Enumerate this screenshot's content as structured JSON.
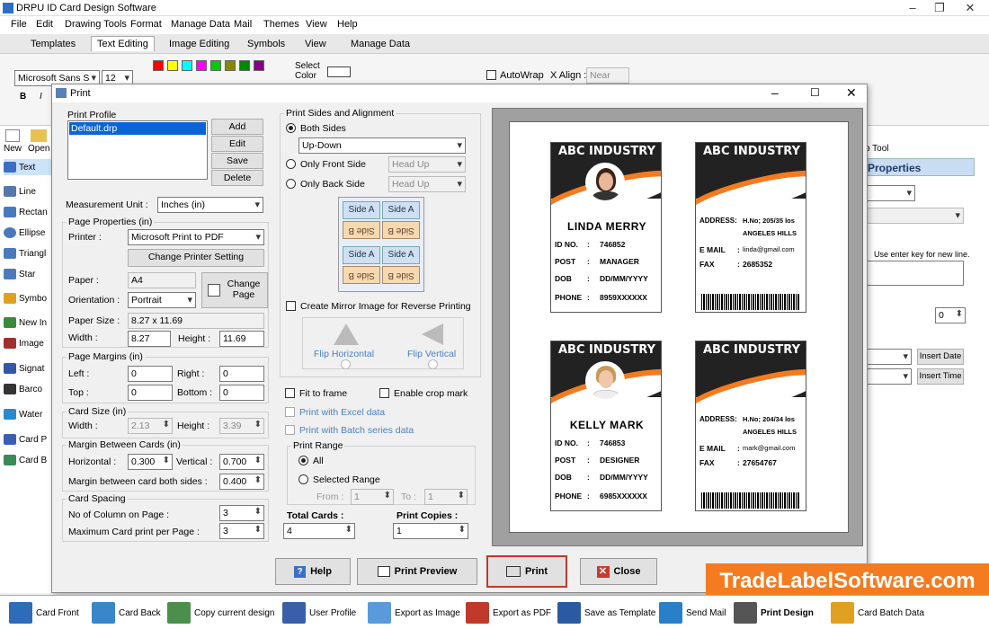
{
  "app": {
    "title": "DRPU ID Card Design Software"
  },
  "menu": [
    "File",
    "Edit",
    "Drawing Tools",
    "Format",
    "Manage Data",
    "Mail",
    "Themes",
    "View",
    "Help"
  ],
  "tabs": [
    "Templates",
    "Text Editing",
    "Image Editing",
    "Symbols",
    "View",
    "Manage Data"
  ],
  "ribbon": {
    "font": "Microsoft Sans S",
    "size": "12",
    "select_color": "Select Color",
    "autowrap": "AutoWrap",
    "xalign": "X Align :",
    "xalign_val": "Near"
  },
  "left_panel": {
    "new": "New",
    "open": "Open",
    "items": [
      "Text",
      "Line",
      "Rectan",
      "Ellipse",
      "Triangl",
      "Star",
      "Symbo",
      "New In",
      "Image",
      "Signat",
      "Barco",
      "Water",
      "Card P",
      "Card B"
    ]
  },
  "right_panel": {
    "tool": "p Tool",
    "properties": "Properties",
    "note": "Use enter key for new line.",
    "spin": "0",
    "insert_date": "Insert Date",
    "insert_time": "Insert Time"
  },
  "dialog": {
    "title": "Print",
    "print_profile": {
      "label": "Print Profile",
      "items": [
        "Default.drp"
      ],
      "add": "Add",
      "edit": "Edit",
      "save": "Save",
      "delete": "Delete"
    },
    "measurement": {
      "label": "Measurement Unit :",
      "value": "Inches (in)"
    },
    "page_props": {
      "label": "Page Properties (in)",
      "printer_label": "Printer :",
      "printer": "Microsoft Print to PDF",
      "change_printer": "Change Printer Setting",
      "paper_label": "Paper :",
      "paper": "A4",
      "orientation_label": "Orientation :",
      "orientation": "Portrait",
      "change_page": "Change Page",
      "paper_size_label": "Paper Size :",
      "paper_size": "8.27 x 11.69",
      "width_label": "Width :",
      "width": "8.27",
      "height_label": "Height :",
      "height": "11.69"
    },
    "margins": {
      "label": "Page Margins (in)",
      "left_label": "Left :",
      "left": "0",
      "right_label": "Right :",
      "right": "0",
      "top_label": "Top :",
      "top": "0",
      "bottom_label": "Bottom :",
      "bottom": "0"
    },
    "card_size": {
      "label": "Card Size (in)",
      "width_label": "Width :",
      "width": "2.13",
      "height_label": "Height :",
      "height": "3.39"
    },
    "margin_between": {
      "label": "Margin Between Cards (in)",
      "horizontal_label": "Horizontal :",
      "horizontal": "0.300",
      "vertical_label": "Vertical :",
      "vertical": "0.700",
      "both_label": "Margin between card both sides :",
      "both": "0.400"
    },
    "spacing": {
      "label": "Card Spacing",
      "columns_label": "No of Column on Page :",
      "columns": "3",
      "max_label": "Maximum Card print per Page :",
      "max": "3"
    },
    "sides": {
      "label": "Print Sides and Alignment",
      "both": "Both Sides",
      "both_mode": "Up-Down",
      "front": "Only Front Side",
      "front_mode": "Head Up",
      "back": "Only Back Side",
      "back_mode": "Head Up",
      "side_a": "Side A",
      "side_b": "Side B",
      "mirror": "Create Mirror Image for Reverse Printing",
      "flip_h": "Flip Horizontal",
      "flip_v": "Flip Vertical"
    },
    "options": {
      "fit": "Fit to frame",
      "crop": "Enable crop mark",
      "excel": "Print with Excel data",
      "batch": "Print with Batch series data"
    },
    "range": {
      "label": "Print Range",
      "all": "All",
      "selected": "Selected Range",
      "from_label": "From :",
      "from": "1",
      "to_label": "To :",
      "to": "1"
    },
    "totals": {
      "total_label": "Total Cards :",
      "total": "4",
      "copies_label": "Print Copies :",
      "copies": "1"
    },
    "buttons": {
      "help": "Help",
      "preview": "Print Preview",
      "print": "Print",
      "close": "Close"
    }
  },
  "cards": [
    {
      "company": "ABC INDUSTRY",
      "name": "LINDA MERRY",
      "id_label": "ID NO.",
      "id": "746852",
      "post_label": "POST",
      "post": "MANAGER",
      "dob_label": "DOB",
      "dob": "DD/MM/YYYY",
      "phone_label": "PHONE",
      "phone": "8959XXXXXX"
    },
    {
      "company": "ABC INDUSTRY",
      "address_label": "ADDRESS:",
      "address1": "H.No; 205/35 los",
      "address2": "ANGELES HILLS",
      "email_label": "E MAIL",
      "email": "linda@gmail.com",
      "fax_label": "FAX",
      "fax": "2685352"
    },
    {
      "company": "ABC INDUSTRY",
      "name": "KELLY MARK",
      "id_label": "ID NO.",
      "id": "746853",
      "post_label": "POST",
      "post": "DESIGNER",
      "dob_label": "DOB",
      "dob": "DD/MM/YYYY",
      "phone_label": "PHONE",
      "phone": "6985XXXXXX"
    },
    {
      "company": "ABC INDUSTRY",
      "address_label": "ADDRESS:",
      "address1": "H.No; 204/34 los",
      "address2": "ANGELES HILLS",
      "email_label": "E MAIL",
      "email": "mark@gmail.com",
      "fax_label": "FAX",
      "fax": "27654767"
    }
  ],
  "taskbar": [
    "Card Front",
    "Card Back",
    "Copy current design",
    "User Profile",
    "Export as Image",
    "Export as PDF",
    "Save as Template",
    "Send Mail",
    "Print Design",
    "Card Batch Data"
  ],
  "brand": "TradeLabelSoftware.com"
}
